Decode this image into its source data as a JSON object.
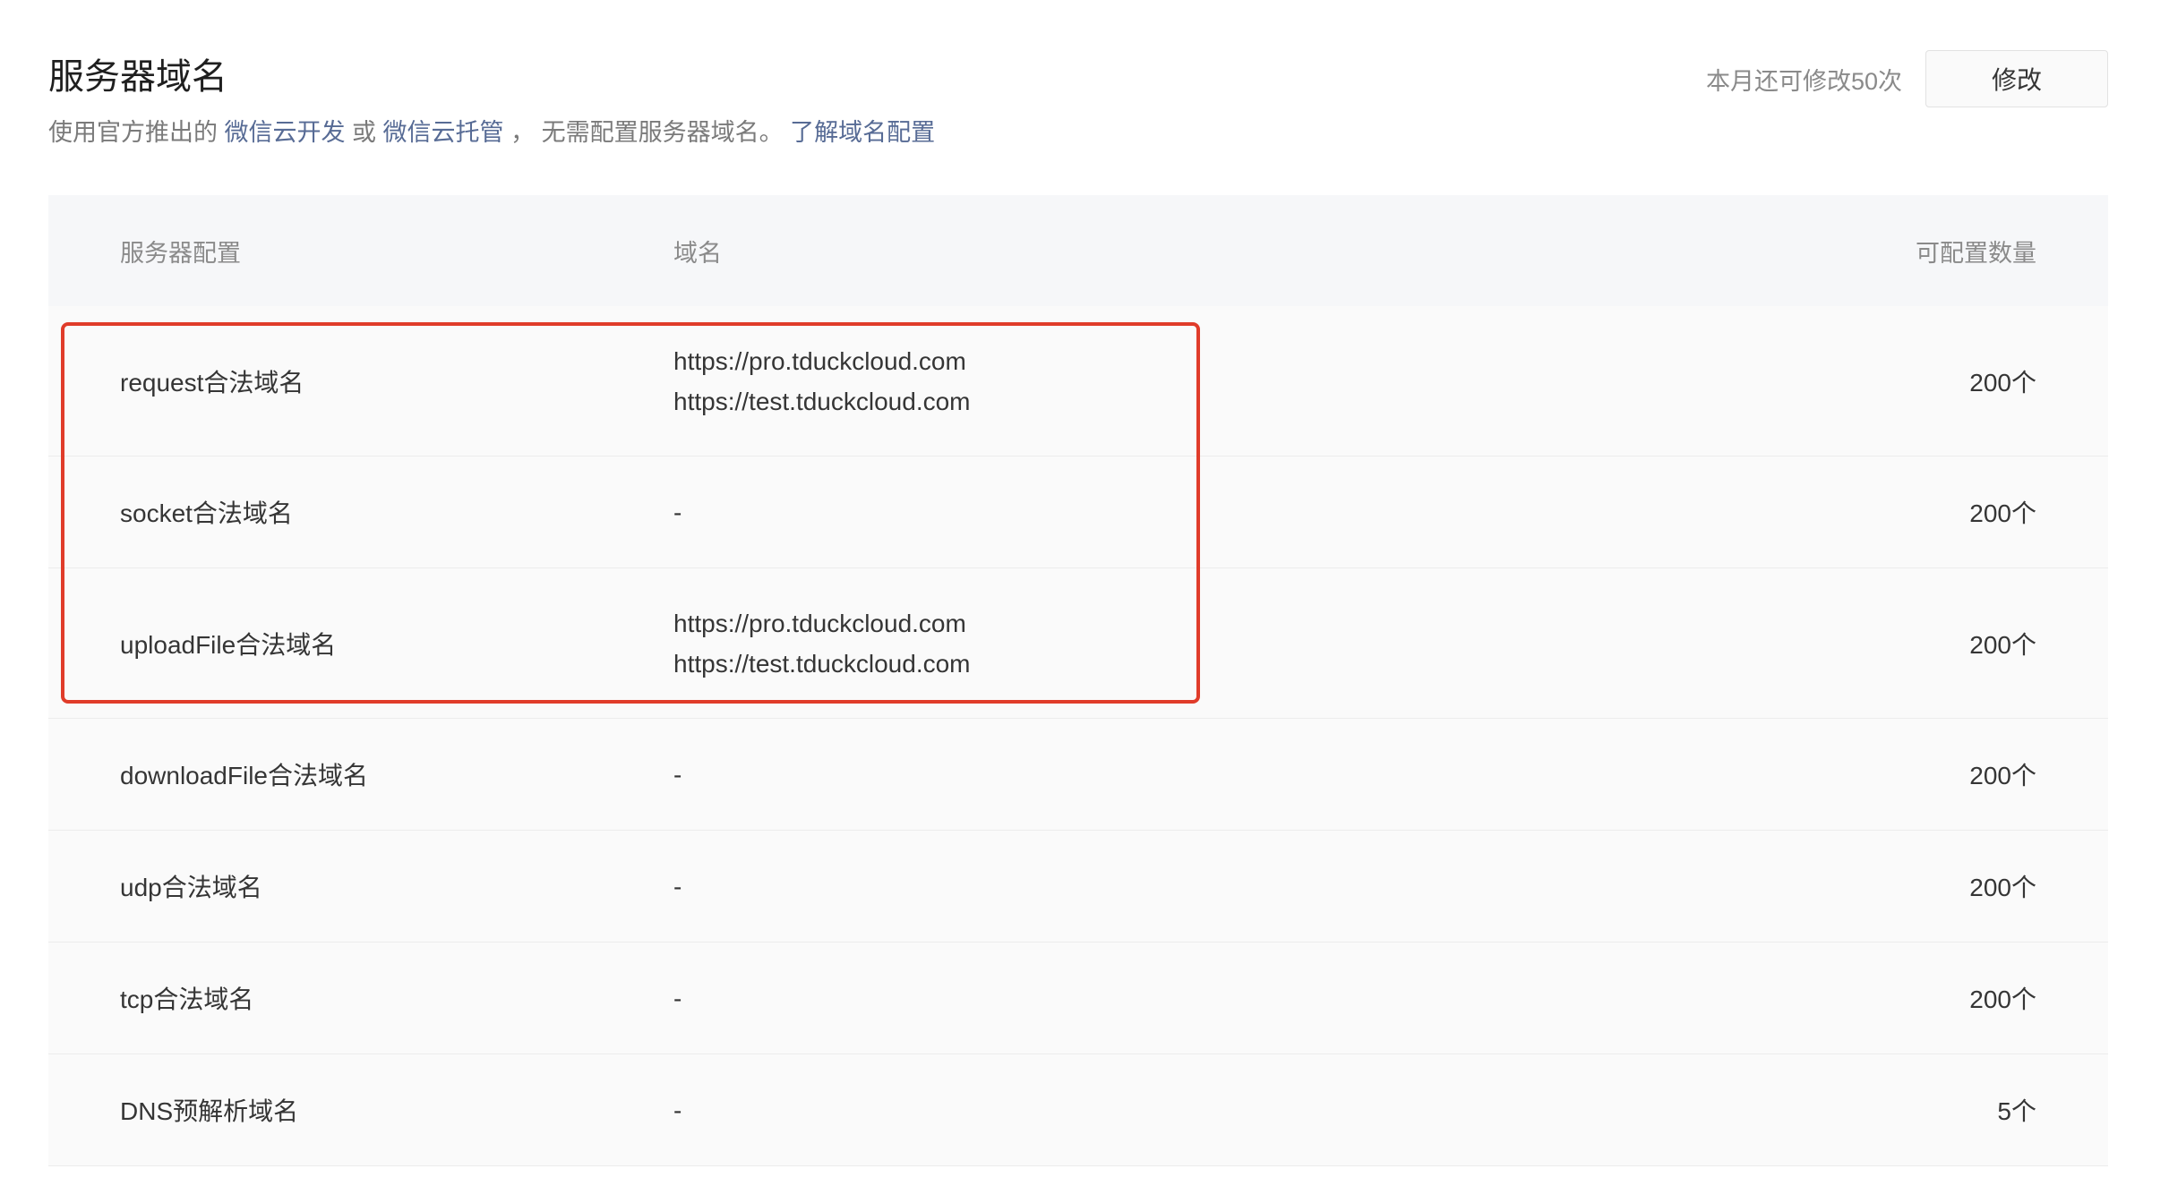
{
  "header": {
    "title": "服务器域名",
    "subtitle_prefix": "使用官方推出的",
    "link_cloud_dev": "微信云开发",
    "or_text": "或",
    "link_cloud_host": "微信云托管",
    "subtitle_middle": "，  无需配置服务器域名。",
    "link_learn": "了解域名配置",
    "remaining": "本月还可修改50次",
    "edit_label": "修改"
  },
  "table": {
    "headers": {
      "config": "服务器配置",
      "domain": "域名",
      "count": "可配置数量"
    },
    "rows": [
      {
        "config": "request合法域名",
        "domains": [
          "https://pro.tduckcloud.com",
          "https://test.tduckcloud.com"
        ],
        "count": "200个"
      },
      {
        "config": "socket合法域名",
        "domains": [
          "-"
        ],
        "count": "200个"
      },
      {
        "config": "uploadFile合法域名",
        "domains": [
          "https://pro.tduckcloud.com",
          "https://test.tduckcloud.com"
        ],
        "count": "200个"
      },
      {
        "config": "downloadFile合法域名",
        "domains": [
          "-"
        ],
        "count": "200个"
      },
      {
        "config": "udp合法域名",
        "domains": [
          "-"
        ],
        "count": "200个"
      },
      {
        "config": "tcp合法域名",
        "domains": [
          "-"
        ],
        "count": "200个"
      },
      {
        "config": "DNS预解析域名",
        "domains": [
          "-"
        ],
        "count": "5个"
      }
    ]
  },
  "colors": {
    "link": "#576b95",
    "highlight_border": "#e03c2a",
    "header_bg": "#f6f7f9",
    "row_bg": "#fafafa"
  }
}
